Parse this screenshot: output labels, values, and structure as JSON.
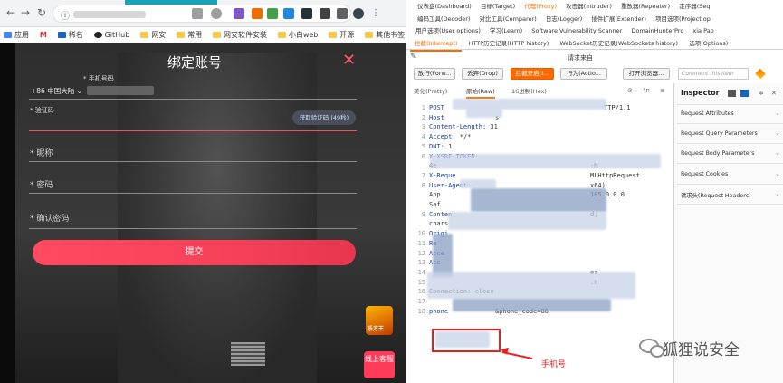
{
  "browser": {
    "bookmarks": [
      "应用",
      "M",
      "稀名",
      "GitHub",
      "网安",
      "常用",
      "网安软件安装",
      "小白web",
      "开源",
      "其他书签"
    ],
    "modal": {
      "title": "绑定账号",
      "close_glyph": "✕",
      "phone_label": "* 手机号码",
      "country_code": "+86 中国大陆 ⌄",
      "code_label": "* 验证码",
      "get_code_button": "获取验证码 (49秒)",
      "nickname_placeholder": "* 昵称",
      "password_placeholder": "* 密码",
      "confirm_password_placeholder": "* 确认密码",
      "submit_button": "提交"
    },
    "ad_badge": "乐方王",
    "ad_service": "线上客服"
  },
  "burp": {
    "menu_row1": [
      "仪表盘(Dashboard)",
      "目标(Target)",
      "代理(Proxy)",
      "攻击器(Intruder)",
      "重放器(Repeater)",
      "定序器(Seq"
    ],
    "menu_row2": [
      "编码工具(Decoder)",
      "对比工具(Comparer)",
      "日志(Logger)",
      "插件扩展(Extender)",
      "项目选项(Project op"
    ],
    "menu_row3": [
      "用户选项(User options)",
      "学习(Learn)",
      "Software Vulnerability Scanner",
      "DomainHunterPro",
      "xia Pao"
    ],
    "active_menu": "代理(Proxy)",
    "sub_tabs": [
      "拦截(Intercept)",
      "HTTP历史记录(HTTP history)",
      "WebSocket历史记录(WebSockets history)",
      "选项(Options)"
    ],
    "request_info": "请求来自",
    "toolbar": {
      "forward": "放行(Forw...",
      "drop": "丢弃(Drop)",
      "intercept_on": "拦截开启(I...",
      "action": "行为(Actio...",
      "open_browser": "打开浏览器...",
      "comment_placeholder": "Comment this item"
    },
    "view_tabs": [
      "美化(Pretty)",
      "原始(Raw)",
      "16进制(Hex)"
    ],
    "view_icons": [
      "⊘",
      "\\n",
      "≡"
    ],
    "request_lines": [
      {
        "n": "1",
        "key": "POST",
        "text": "",
        "tail": "TTP/1.1"
      },
      {
        "n": "2",
        "key": "Host",
        "text": "",
        "tail": "s"
      },
      {
        "n": "3",
        "key": "Content-Length:",
        "text": " 31",
        "tail": ""
      },
      {
        "n": "4",
        "key": "Accept:",
        "text": " */*",
        "tail": ""
      },
      {
        "n": "5",
        "key": "DNT:",
        "text": " 1",
        "tail": ""
      },
      {
        "n": "6",
        "key": "X-XSRF-TOKEN:",
        "text": "",
        "tail": ""
      },
      {
        "n": "",
        "key": "",
        "text": "4e",
        "tail": "-M"
      },
      {
        "n": "7",
        "key": "X-Reque",
        "text": "",
        "tail": "MLHttpRequest"
      },
      {
        "n": "8",
        "key": "User-Agent:",
        "text": "",
        "tail": "x64)"
      },
      {
        "n": "",
        "key": "",
        "text": "App",
        "tail": "105.0.0.0"
      },
      {
        "n": "",
        "key": "",
        "text": "Saf",
        "tail": ""
      },
      {
        "n": "9",
        "key": "Conten",
        "text": "",
        "tail": "d;"
      },
      {
        "n": "",
        "key": "",
        "text": "chars",
        "tail": ""
      },
      {
        "n": "10",
        "key": "Origi",
        "text": "",
        "tail": ""
      },
      {
        "n": "11",
        "key": "Re",
        "text": "",
        "tail": ""
      },
      {
        "n": "12",
        "key": "Acce",
        "text": "",
        "tail": ""
      },
      {
        "n": "13",
        "key": "Acc",
        "text": "",
        "tail": ""
      },
      {
        "n": "14",
        "key": "",
        "text": "",
        "tail": "ea"
      },
      {
        "n": "15",
        "key": "",
        "text": "",
        "tail": ".0"
      },
      {
        "n": "16",
        "key": "",
        "text": "Connection: close",
        "tail": ""
      },
      {
        "n": "17",
        "key": "",
        "text": "",
        "tail": ""
      },
      {
        "n": "18",
        "key": "phone",
        "text": "",
        "tail": "&phone_code=86"
      }
    ],
    "inspector": {
      "title": "Inspector",
      "items": [
        "Request Attributes",
        "Request Query Parameters",
        "Request Body Parameters",
        "Request Cookies",
        "请求头(Request Headers)"
      ]
    }
  },
  "annotation": {
    "phone_label": "手机号"
  },
  "watermark": "狐狸说安全"
}
